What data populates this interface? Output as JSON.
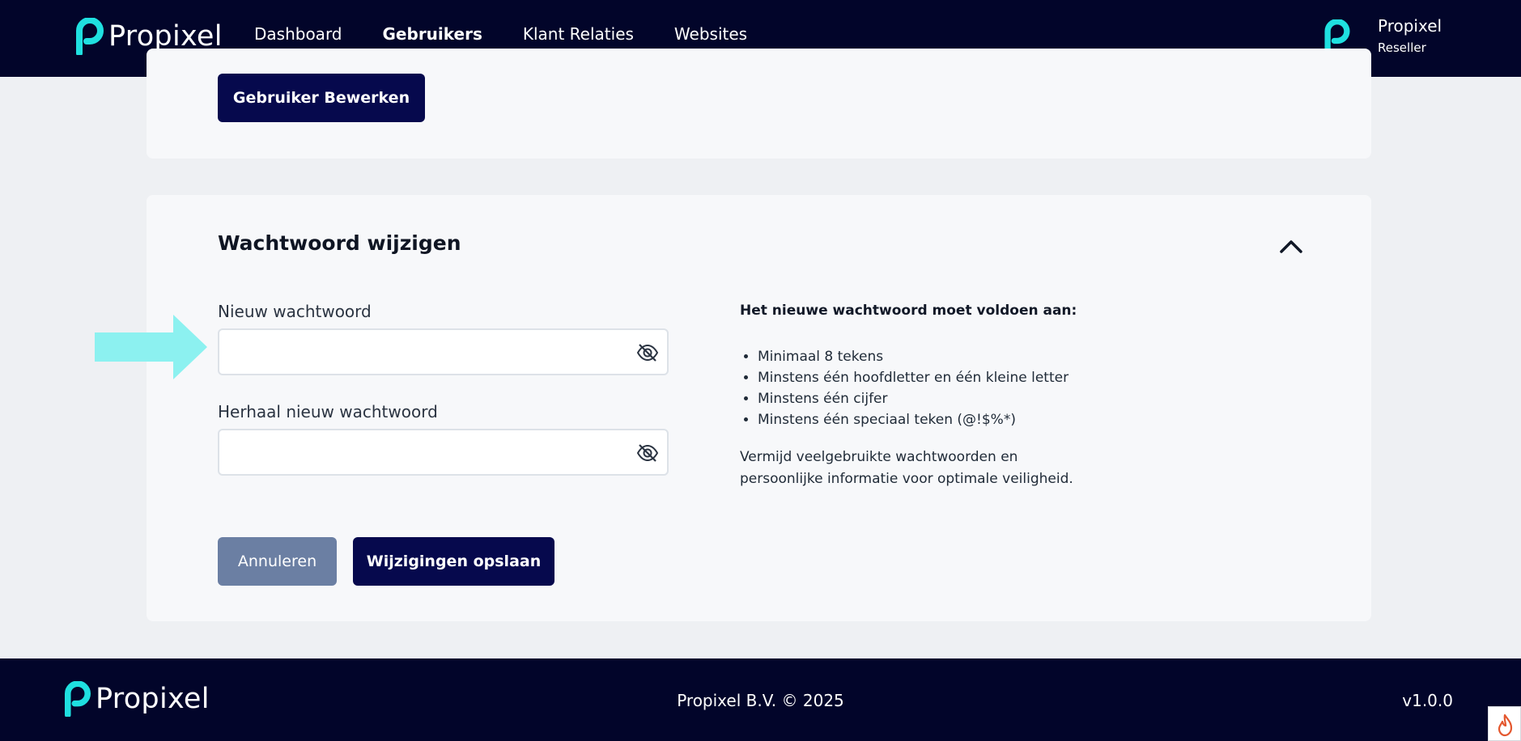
{
  "header": {
    "brand": "Propixel",
    "nav": [
      {
        "label": "Dashboard",
        "active": false
      },
      {
        "label": "Gebruikers",
        "active": true
      },
      {
        "label": "Klant Relaties",
        "active": false
      },
      {
        "label": "Websites",
        "active": false
      }
    ],
    "user": {
      "name": "Propixel",
      "role": "Reseller"
    }
  },
  "top_card": {
    "edit_button": "Gebruiker Bewerken"
  },
  "password_card": {
    "title": "Wachtwoord wijzigen",
    "new_password": {
      "label": "Nieuw wachtwoord",
      "value": "",
      "placeholder": ""
    },
    "repeat_password": {
      "label": "Herhaal nieuw wachtwoord",
      "value": "",
      "placeholder": ""
    },
    "requirements": {
      "heading": "Het nieuwe wachtwoord moet voldoen aan:",
      "items": [
        "Minimaal 8 tekens",
        "Minstens één hoofdletter en één kleine letter",
        "Minstens één cijfer",
        "Minstens één speciaal teken (@!$%*)"
      ],
      "note": "Vermijd veelgebruikte wachtwoorden en persoonlijke informatie voor optimale veiligheid."
    },
    "cancel_button": "Annuleren",
    "save_button": "Wijzigingen opslaan"
  },
  "footer": {
    "brand": "Propixel",
    "copyright": "Propixel B.V. © 2025",
    "version": "v1.0.0"
  },
  "colors": {
    "navy": "#02052a",
    "button_navy": "#06094d",
    "muted_button": "#6b7fa3",
    "accent_cyan": "#1fe0e0",
    "arrow_cyan": "#8cf1f0"
  },
  "icons": {
    "logo": "propixel-logo-icon",
    "collapse": "chevron-up-icon",
    "visibility": "eye-slash-icon",
    "arrow": "arrow-right-icon",
    "corner": "flame-icon"
  }
}
